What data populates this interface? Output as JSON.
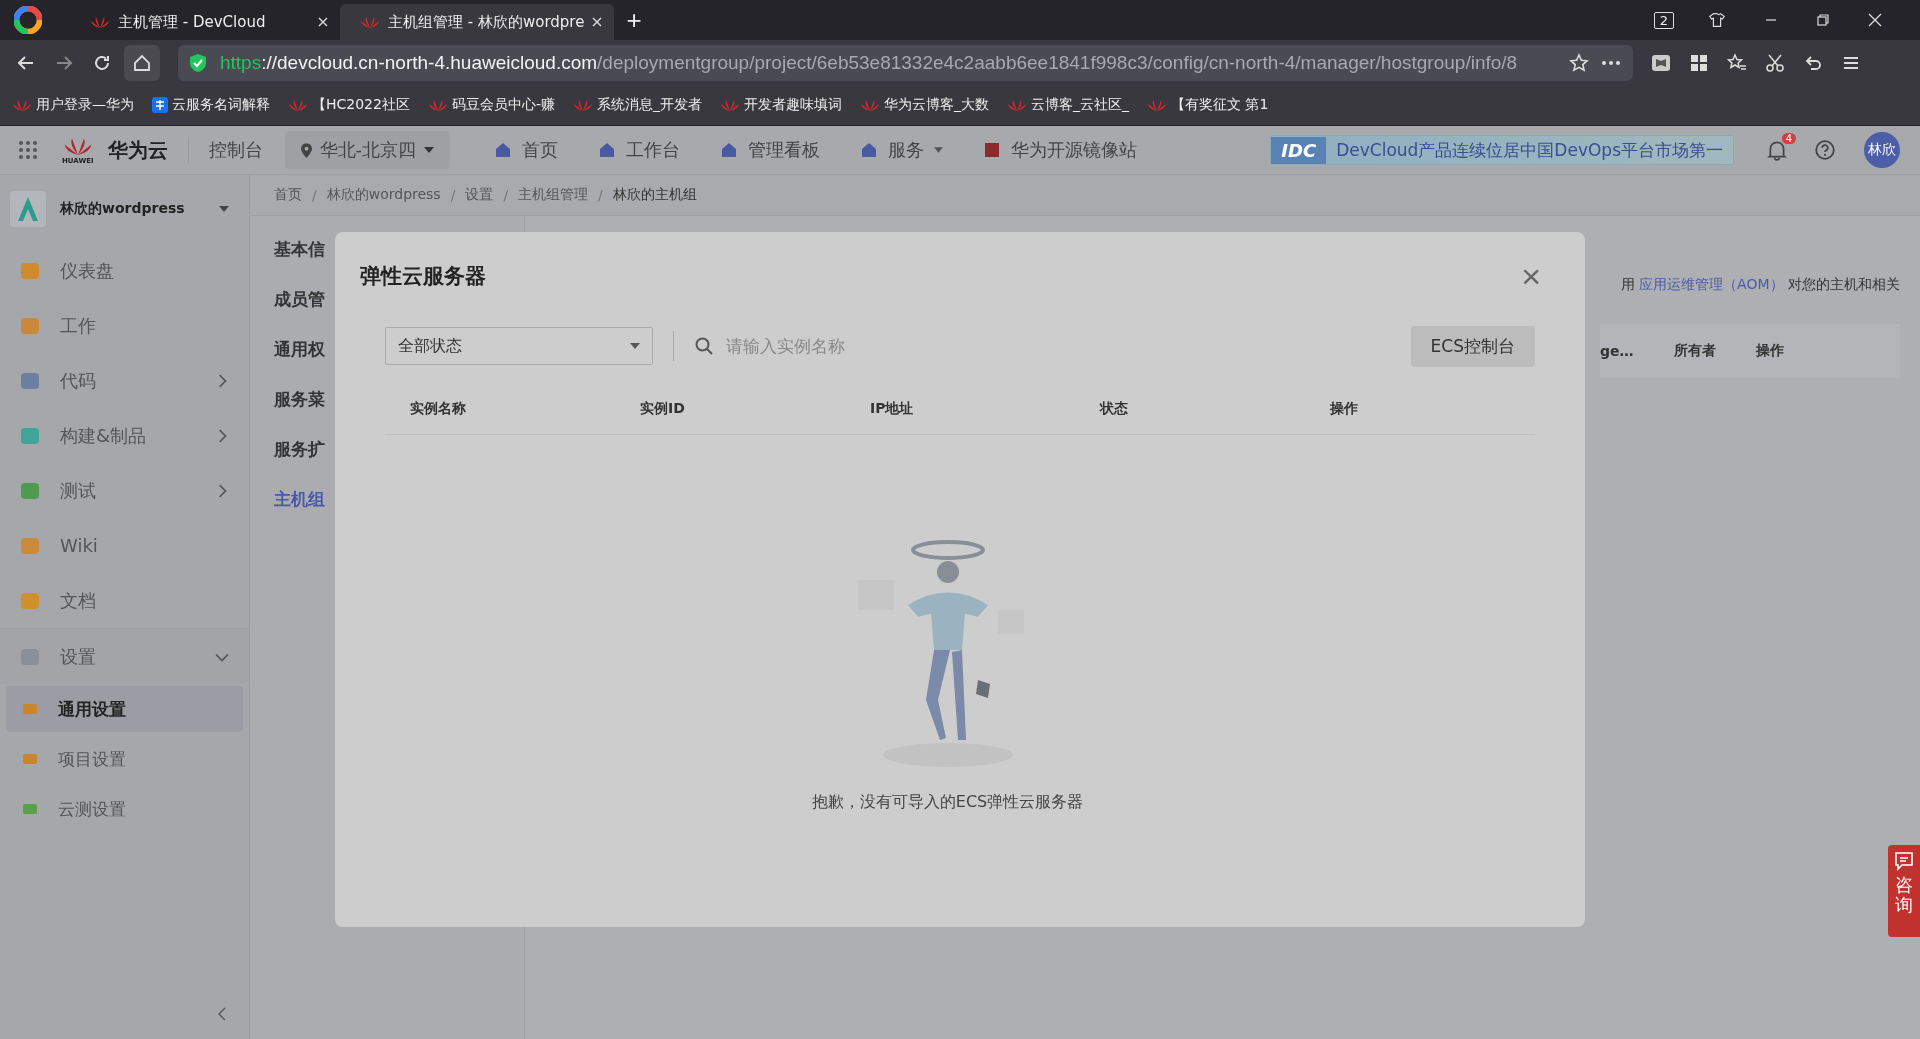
{
  "browser": {
    "tabs": [
      {
        "title": "主机管理 - DevCloud",
        "selected": false
      },
      {
        "title": "主机组管理 - 林欣的wordpre",
        "selected": true
      }
    ],
    "new_tab": "+",
    "tab_count": "2",
    "url": {
      "scheme": "https",
      "host": "://devcloud.cn-north-4.huaweicloud.com",
      "path": "/deploymentgroup/project/6eb53e81332e4c2aabb6ee1841f998c3/config/cn-north-4/manager/hostgroup/info/8"
    },
    "bookmarks": [
      {
        "label": "用户登录—华为",
        "kind": "logo"
      },
      {
        "label": "云服务名词解释",
        "kind": "zhi"
      },
      {
        "label": "【HC2022社区",
        "kind": "logo"
      },
      {
        "label": "码豆会员中心-赚",
        "kind": "logo"
      },
      {
        "label": "系统消息_开发者",
        "kind": "logo"
      },
      {
        "label": "开发者趣味填词",
        "kind": "logo"
      },
      {
        "label": "华为云博客_大数",
        "kind": "logo"
      },
      {
        "label": "云博客_云社区_",
        "kind": "logo"
      },
      {
        "label": "【有奖征文 第1",
        "kind": "logo"
      }
    ]
  },
  "header": {
    "brand": "华为云",
    "brand_sub": "HUAWEI",
    "console": "控制台",
    "region": "华北-北京四",
    "nav": [
      {
        "label": "首页",
        "dropdown": false
      },
      {
        "label": "工作台",
        "dropdown": false
      },
      {
        "label": "管理看板",
        "dropdown": false
      },
      {
        "label": "服务",
        "dropdown": true
      },
      {
        "label": "华为开源镜像站",
        "dropdown": false
      }
    ],
    "banner_badge": "IDC",
    "banner": "DevCloud产品连续位居中国DevOps平台市场第一",
    "notifications": "4",
    "avatar": "林欣"
  },
  "sidebar": {
    "project": "林欣的wordpress",
    "items": [
      {
        "label": "仪表盘",
        "expandable": false,
        "expanded": false,
        "color": "#d08a2c"
      },
      {
        "label": "工作",
        "expandable": false,
        "expanded": false,
        "color": "#c9883a"
      },
      {
        "label": "代码",
        "expandable": true,
        "expanded": false,
        "color": "#6b7fa0"
      },
      {
        "label": "构建&制品",
        "expandable": true,
        "expanded": false,
        "color": "#3fa59a"
      },
      {
        "label": "测试",
        "expandable": true,
        "expanded": false,
        "color": "#4f9a4f"
      },
      {
        "label": "Wiki",
        "expandable": false,
        "expanded": false,
        "color": "#c98a3a"
      },
      {
        "label": "文档",
        "expandable": false,
        "expanded": false,
        "color": "#d0902e"
      },
      {
        "label": "设置",
        "expandable": true,
        "expanded": true,
        "color": "#8a8f99",
        "children": [
          {
            "label": "通用设置",
            "selected": true,
            "color": "#c9842c"
          },
          {
            "label": "项目设置",
            "selected": false,
            "color": "#c9842c"
          },
          {
            "label": "云测设置",
            "selected": false,
            "color": "#5aa04a"
          }
        ]
      }
    ]
  },
  "breadcrumb": {
    "separator": "/",
    "items": [
      "首页",
      "林欣的wordpress",
      "设置",
      "主机组管理",
      "林欣的主机组"
    ]
  },
  "settings_nav": [
    {
      "label": "基本信",
      "selected": false
    },
    {
      "label": "成员管",
      "selected": false
    },
    {
      "label": "通用权",
      "selected": false
    },
    {
      "label": "服务菜",
      "selected": false
    },
    {
      "label": "服务扩",
      "selected": false
    },
    {
      "label": "主机组",
      "selected": true
    }
  ],
  "content": {
    "hint_start": "用",
    "hint_link": "应用运维管理（AOM）",
    "hint_end": "对您的主机和相关",
    "table_columns": [
      "ge…",
      "所有者",
      "操作"
    ]
  },
  "dialog": {
    "title": "弹性云服务器",
    "close": "×",
    "status_filter": "全部状态",
    "search": {
      "placeholder": "请输入实例名称"
    },
    "console_button": "ECS控制台",
    "columns": [
      "实例名称",
      "实例ID",
      "IP地址",
      "状态",
      "操作"
    ],
    "empty_message": "抱歉，没有可导入的ECS弹性云服务器"
  },
  "consult": "咨询"
}
